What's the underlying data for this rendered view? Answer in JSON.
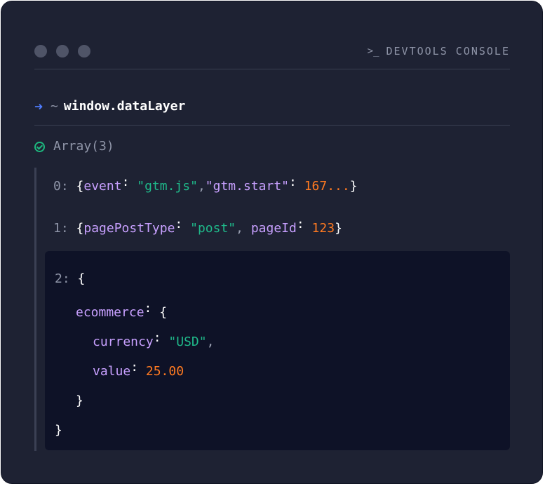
{
  "header": {
    "title": "DEVTOOLS CONSOLE",
    "prompt_glyph": ">_"
  },
  "command": {
    "arrow_icon": "right-arrow-icon",
    "tilde": "~",
    "text": "window.dataLayer"
  },
  "result": {
    "label": "Array(3)",
    "icon": "check-circle-icon"
  },
  "entries": [
    {
      "index": "0:",
      "open": "{",
      "key1": "event",
      "val1": "\"gtm.js\"",
      "key2": "\"gtm.start\"",
      "val2": "167...",
      "close": "}"
    },
    {
      "index": "1:",
      "open": "{",
      "key1": "pagePostType",
      "val1": "\"post\"",
      "key2": "pageId",
      "val2": "123",
      "close": "}"
    }
  ],
  "expanded": {
    "index": "2:",
    "open": "{",
    "ecommerce_key": "ecommerce",
    "ecommerce_open": "{",
    "currency_key": "currency",
    "currency_val": "\"USD\"",
    "value_key": "value",
    "value_val": "25.00",
    "ecommerce_close": "}",
    "close": "}"
  },
  "colors": {
    "background": "#1e2233",
    "panel": "#0e1227",
    "key": "#c8a0ff",
    "string": "#1fb98a",
    "number": "#ff7a21",
    "arrow": "#4f7dff"
  }
}
